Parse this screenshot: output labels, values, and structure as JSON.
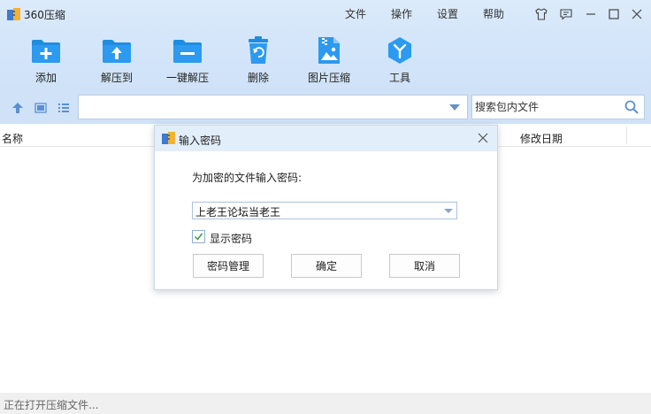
{
  "app": {
    "title": "360压缩"
  },
  "menu": [
    "文件",
    "操作",
    "设置",
    "帮助"
  ],
  "toolbar": [
    {
      "label": "添加",
      "icon": "folder-add-icon"
    },
    {
      "label": "解压到",
      "icon": "folder-extract-icon"
    },
    {
      "label": "一键解压",
      "icon": "folder-one-click-extract-icon"
    },
    {
      "label": "删除",
      "icon": "trash-icon"
    },
    {
      "label": "图片压缩",
      "icon": "image-compress-icon"
    },
    {
      "label": "工具",
      "icon": "tools-icon"
    }
  ],
  "search": {
    "placeholder": "搜索包内文件"
  },
  "filelist": {
    "columns": {
      "name": "名称",
      "date": "修改日期"
    }
  },
  "status": {
    "text": "正在打开压缩文件..."
  },
  "dialog": {
    "title": "输入密码",
    "prompt": "为加密的文件输入密码:",
    "password": "上老王论坛当老王",
    "show_password_label": "显示密码",
    "show_password_checked": true,
    "buttons": {
      "manage": "密码管理",
      "ok": "确定",
      "cancel": "取消"
    }
  },
  "colors": {
    "accent": "#1e8de0",
    "titlebar": "#dcebfb",
    "toolbar": "#cfe2f8"
  }
}
